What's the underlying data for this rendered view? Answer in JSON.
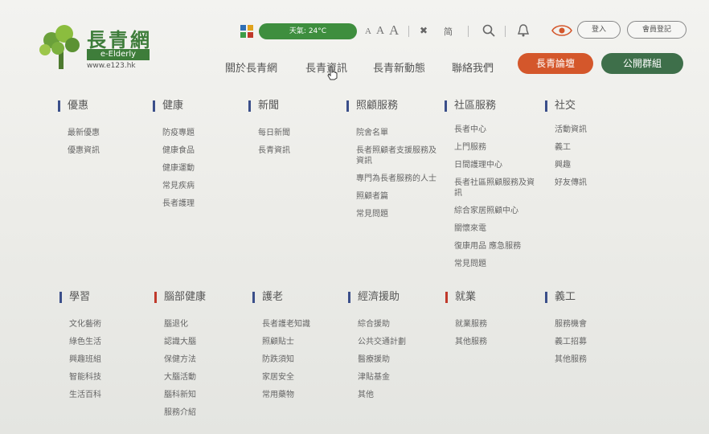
{
  "brand": {
    "name": "長青網",
    "sub": "e-Elderly",
    "url": "www.e123.hk"
  },
  "utility": {
    "weather": "天氣: 24°C",
    "font_small": "A",
    "font_medium": "A",
    "font_large": "A",
    "search_label": "搜索",
    "login_label": "登入",
    "register_label": "會員登記"
  },
  "nav": {
    "items": [
      "關於長青網",
      "長青資訊",
      "長青新動態",
      "聯絡我們"
    ],
    "cta_primary": "長青論壇",
    "cta_secondary": "公開群組"
  },
  "menu": {
    "row1": [
      {
        "title": "優惠",
        "items": [
          "最新優惠",
          "優惠資訊"
        ]
      },
      {
        "title": "健康",
        "items": [
          "防疫專題",
          "健康食品",
          "健康運動",
          "常見疾病",
          "長者護理"
        ]
      },
      {
        "title": "新聞",
        "items": [
          "每日新聞",
          "長青資訊"
        ]
      },
      {
        "title": "照顧服務",
        "items": [
          "院舍名單",
          "長者照顧者支援服務及資訊",
          "專門為長者服務的人士",
          "照顧者篇",
          "常見問題"
        ]
      },
      {
        "title": "社區服務",
        "items": [
          "長者中心",
          "上門服務",
          "日間護理中心",
          "長者社區照顧服務及資訊",
          "綜合家居照顧中心",
          "關懷來電",
          "復康用品 應急服務",
          "常見問題"
        ]
      },
      {
        "title": "社交",
        "items": [
          "活動資訊",
          "義工",
          "興趣",
          "好友傳訊"
        ]
      }
    ],
    "row2": [
      {
        "title": "學習",
        "items": [
          "文化藝術",
          "綠色生活",
          "興趣班組",
          "智能科技",
          "生活百科"
        ]
      },
      {
        "title": "腦部健康",
        "items": [
          "腦退化",
          "認識大腦",
          "保健方法",
          "大腦活動",
          "腦科新知",
          "服務介紹"
        ]
      },
      {
        "title": "護老",
        "items": [
          "長者護老知識",
          "照顧貼士",
          "防跌須知",
          "家居安全",
          "常用藥物"
        ]
      },
      {
        "title": "經濟援助",
        "items": [
          "綜合援助",
          "公共交通計劃",
          "醫療援助",
          "津貼基金",
          "其他"
        ]
      },
      {
        "title": "就業",
        "items": [
          "就業服務",
          "其他服務"
        ]
      },
      {
        "title": "義工",
        "items": [
          "服務機會",
          "義工招募",
          "其他服務"
        ]
      }
    ]
  }
}
